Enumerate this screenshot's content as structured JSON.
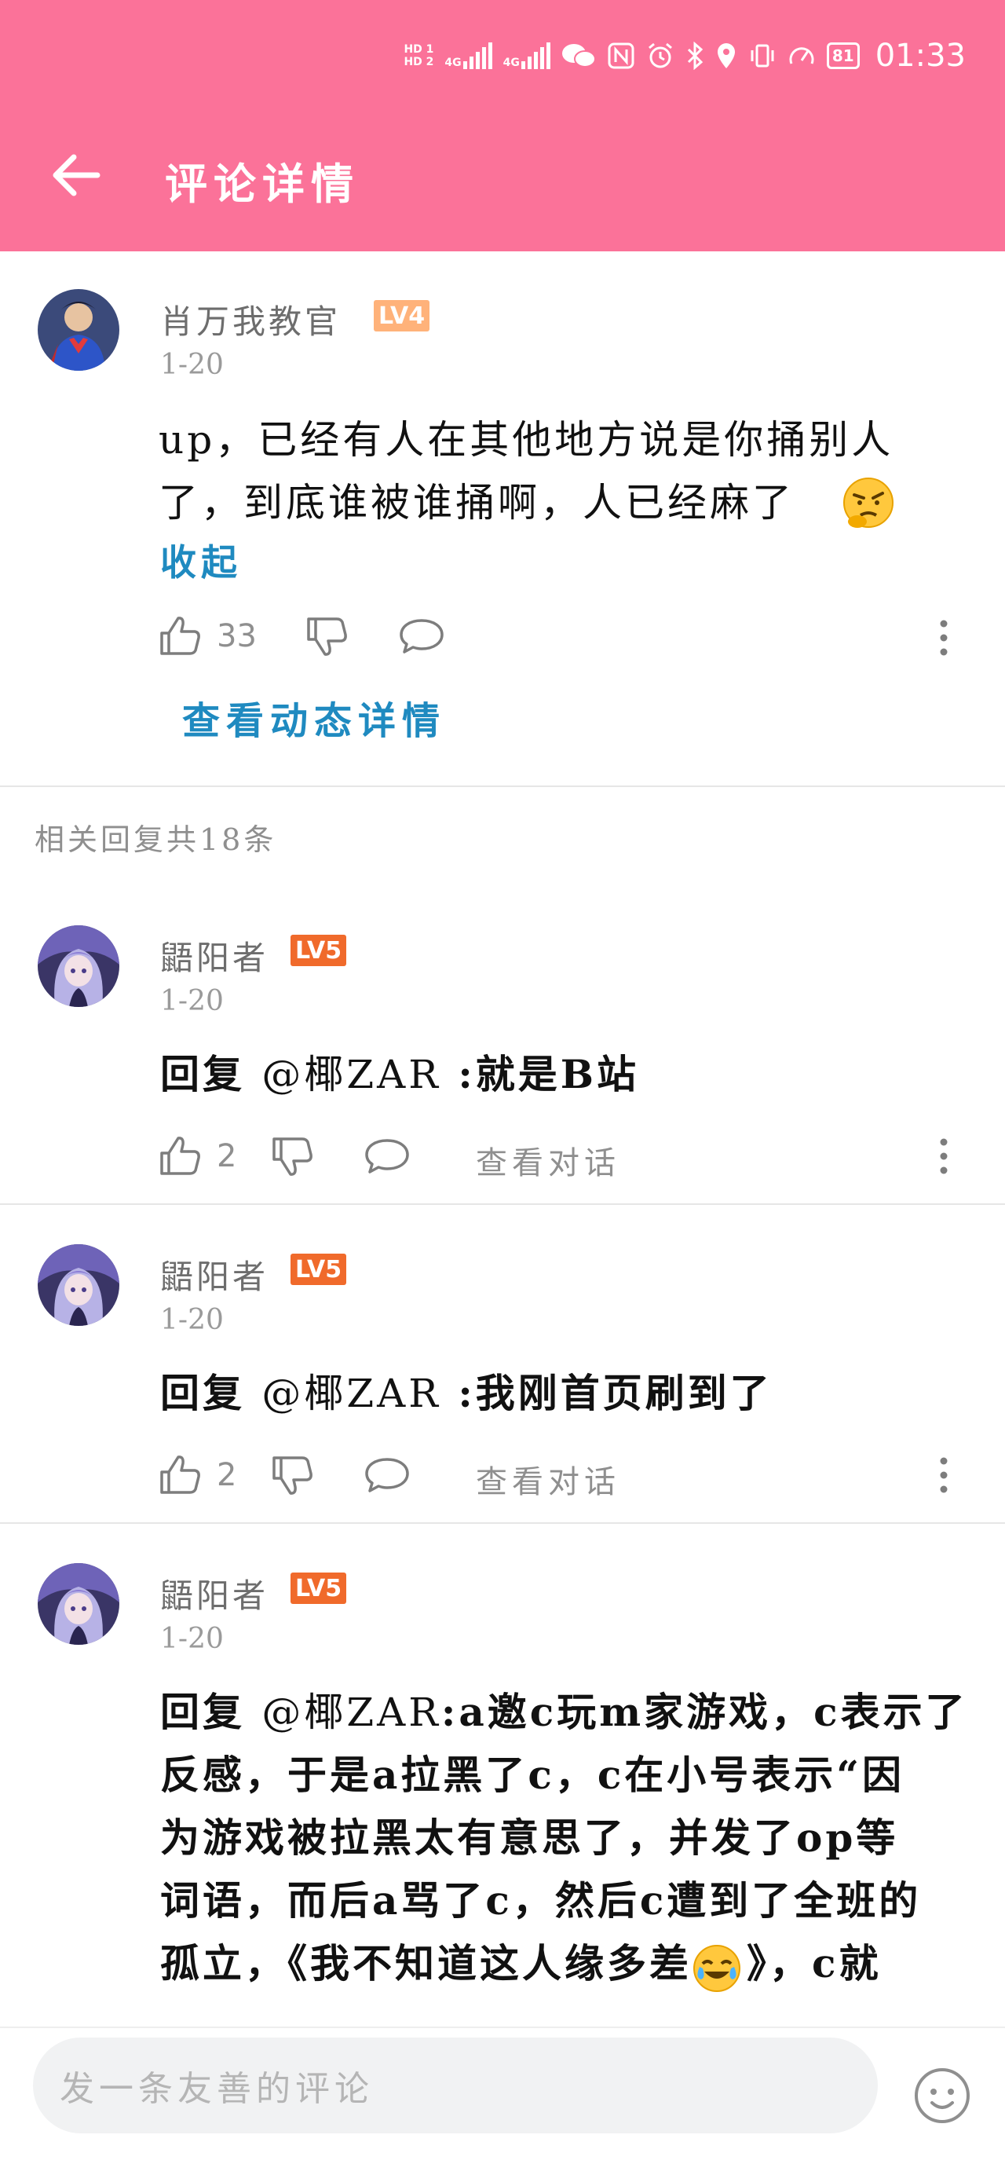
{
  "status_bar": {
    "hd1": "HD 1",
    "hd2": "HD 2",
    "sig1": "4G",
    "sig2": "4G",
    "battery": "81",
    "time": "01:33"
  },
  "appbar": {
    "title": "评论详情"
  },
  "main_comment": {
    "username": "肖万我教官",
    "level": "LV4",
    "date": "1-20",
    "text_line1": "up，已经有人在其他地方说是你捅别人",
    "text_line2": "了，到底谁被谁捅啊，人已经麻了",
    "collapse": "收起",
    "likes": "33",
    "view_detail": "查看动态详情"
  },
  "replies_header": "相关回复共18条",
  "replies": [
    {
      "username": "鼯阳者",
      "level": "LV5",
      "date": "1-20",
      "prefix": "回复",
      "mention": "@椰ZAR",
      "text": ":就是B站",
      "likes": "2",
      "view_conversation": "查看对话"
    },
    {
      "username": "鼯阳者",
      "level": "LV5",
      "date": "1-20",
      "prefix": "回复",
      "mention": "@椰ZAR",
      "text": ":我刚首页刷到了",
      "likes": "2",
      "view_conversation": "查看对话"
    },
    {
      "username": "鼯阳者",
      "level": "LV5",
      "date": "1-20",
      "prefix": "回复",
      "mention": "@椰ZAR",
      "text_line1": ":a邀c玩m家游戏，c表示了",
      "text_line2": "反感，于是a拉黑了c，c在小号表示“因",
      "text_line3": "为游戏被拉黑太有意思了，并发了op等",
      "text_line4": "词语，而后a骂了c，然后c遭到了全班的",
      "text_line5a": "孤立，《我不知道这人缘多差",
      "text_line5b": "》，c就"
    }
  ],
  "input": {
    "placeholder": "发一条友善的评论"
  }
}
